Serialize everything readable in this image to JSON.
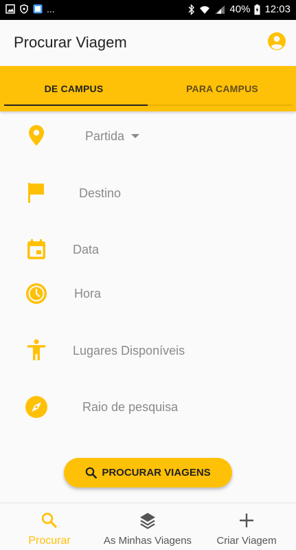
{
  "status_bar": {
    "battery": "40%",
    "time": "12:03",
    "overflow": "..."
  },
  "app_bar": {
    "title": "Procurar Viagem",
    "account_icon": "account-circle-icon"
  },
  "tabs": [
    {
      "label": "DE CAMPUS",
      "selected": true
    },
    {
      "label": "PARA CAMPUS",
      "selected": false
    }
  ],
  "form": {
    "partida": {
      "label": "Partida",
      "icon": "location-pin-icon"
    },
    "destino": {
      "label": "Destino",
      "icon": "flag-icon"
    },
    "data": {
      "label": "Data",
      "icon": "calendar-icon"
    },
    "hora": {
      "label": "Hora",
      "icon": "clock-icon"
    },
    "lugares": {
      "label": "Lugares Disponíveis",
      "icon": "person-icon"
    },
    "raio": {
      "label": "Raio de pesquisa",
      "icon": "compass-icon"
    }
  },
  "search_button": {
    "label": "PROCURAR VIAGENS",
    "icon": "search-icon"
  },
  "bottom_nav": [
    {
      "label": "Procurar",
      "icon": "search-icon",
      "active": true
    },
    {
      "label": "As Minhas Viagens",
      "icon": "layers-icon",
      "active": false
    },
    {
      "label": "Criar Viagem",
      "icon": "plus-icon",
      "active": false
    }
  ],
  "colors": {
    "accent": "#ffc107",
    "label_grey": "#8a8a8a"
  }
}
